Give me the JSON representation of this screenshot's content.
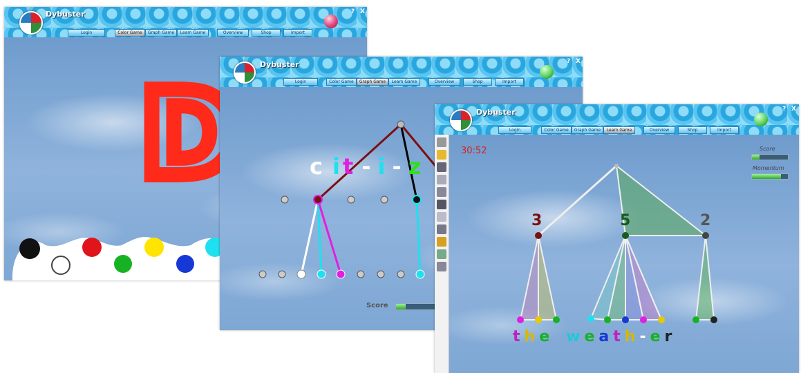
{
  "app_title": "Dybuster",
  "tabs": [
    "Login",
    "Color Game",
    "Graph Game",
    "Learn Game",
    "Overview",
    "Shop",
    "Import"
  ],
  "window_controls": {
    "help": "?",
    "close": "X"
  },
  "win1": {
    "active_tab": 1,
    "big_letter": "D",
    "orb_color": "#e0457a"
  },
  "win2": {
    "active_tab": 2,
    "word": [
      "c",
      "i",
      "t",
      "-",
      "i",
      "-",
      "z"
    ],
    "score_label": "Score",
    "score": 0.25,
    "orb_color": "#5cd35c"
  },
  "win3": {
    "active_tab": 3,
    "timer": "30:52",
    "score_label": "Score",
    "momentum_label": "Momentum",
    "score": 0.22,
    "momentum": 0.8,
    "counts": [
      "3",
      "5",
      "2"
    ],
    "word": [
      "t",
      "h",
      "e",
      " ",
      "w",
      "e",
      "a",
      "t",
      "h",
      "-",
      "e",
      "r"
    ],
    "orb_color": "#5cd35c"
  },
  "colors": {
    "accent_red": "#ff2a1a",
    "tree_line": "#7a1010"
  }
}
